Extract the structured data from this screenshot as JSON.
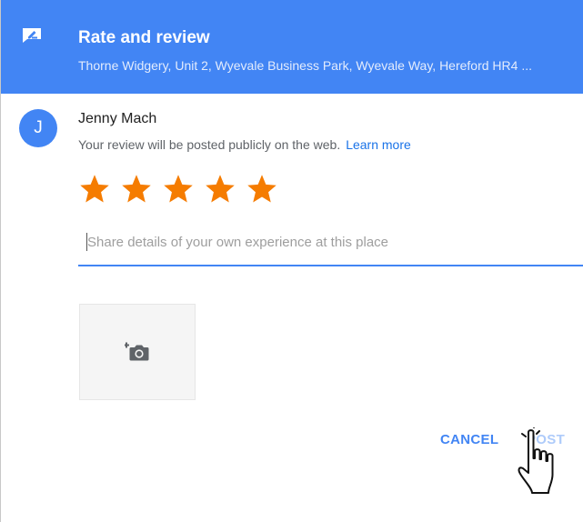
{
  "header": {
    "title": "Rate and review",
    "subtitle": "Thorne Widgery, Unit 2, Wyevale Business Park, Wyevale Way, Hereford HR4 ...",
    "icon": "edit-review-icon"
  },
  "user": {
    "initial": "J",
    "name": "Jenny Mach",
    "notice": "Your review will be posted publicly on the web.",
    "learn_more": "Learn more"
  },
  "rating": {
    "value": 5,
    "max": 5,
    "star_color": "#f57c00"
  },
  "review": {
    "placeholder": "Share details of your own experience at this place",
    "value": ""
  },
  "photo": {
    "icon": "add-photo-icon"
  },
  "actions": {
    "cancel_label": "CANCEL",
    "post_label": "POST"
  },
  "colors": {
    "accent": "#4285f4",
    "link": "#1a73e8",
    "disabled": "#aecbfa"
  }
}
